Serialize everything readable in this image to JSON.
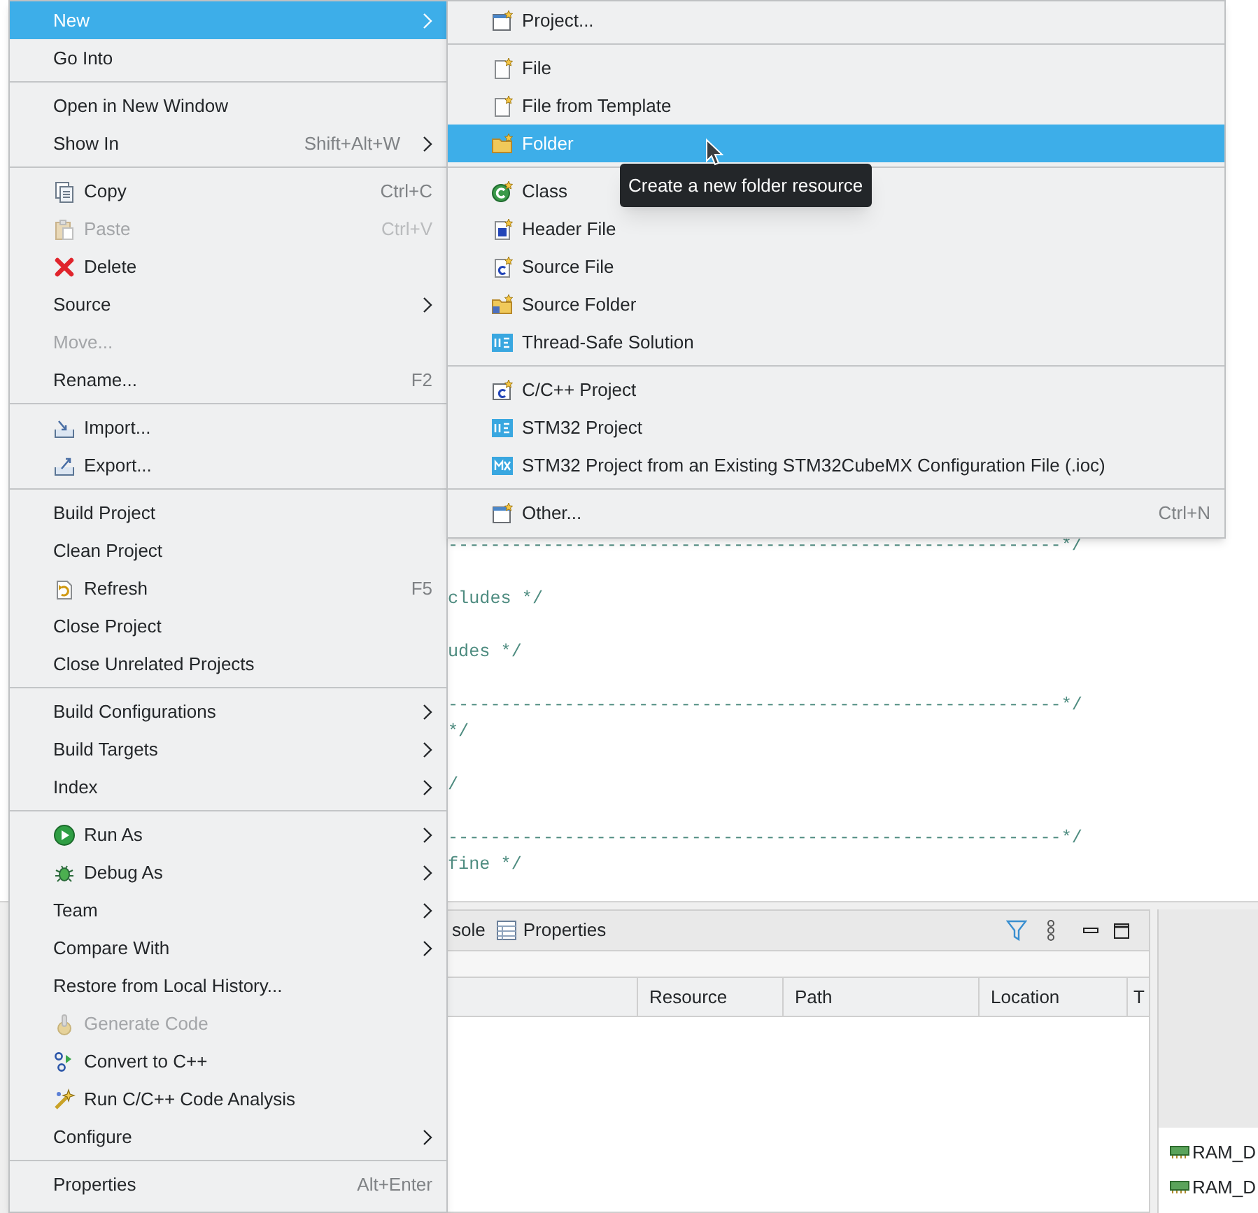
{
  "editor": {
    "lines": [
      "----------------------------------------------------------*/",
      "cludes */",
      "udes */",
      "----------------------------------------------------------*/",
      "*/",
      "/",
      "----------------------------------------------------------*/",
      "fine */"
    ]
  },
  "bottom_panel": {
    "tabs": [
      {
        "label": "sole",
        "selected": false
      },
      {
        "label": "Properties",
        "selected": false
      }
    ],
    "table": {
      "columns": [
        "Resource",
        "Path",
        "Location",
        "T"
      ]
    }
  },
  "outline_panel": {
    "items": [
      {
        "label": "RAM_D"
      },
      {
        "label": "RAM_D"
      }
    ]
  },
  "context_menu": {
    "items": [
      {
        "kind": "item",
        "label": "New",
        "submenu": true,
        "selected": true,
        "disabled": false
      },
      {
        "kind": "item",
        "label": "Go Into",
        "submenu": false,
        "selected": false,
        "disabled": false
      },
      {
        "kind": "separator"
      },
      {
        "kind": "item",
        "label": "Open in New Window",
        "submenu": false,
        "selected": false,
        "disabled": false
      },
      {
        "kind": "item",
        "label": "Show In",
        "shortcut": "Shift+Alt+W",
        "submenu": true,
        "selected": false,
        "disabled": false
      },
      {
        "kind": "separator"
      },
      {
        "kind": "item",
        "label": "Copy",
        "shortcut": "Ctrl+C",
        "submenu": false,
        "selected": false,
        "disabled": false
      },
      {
        "kind": "item",
        "label": "Paste",
        "shortcut": "Ctrl+V",
        "submenu": false,
        "selected": false,
        "disabled": true
      },
      {
        "kind": "item",
        "label": "Delete",
        "submenu": false,
        "selected": false,
        "disabled": false
      },
      {
        "kind": "item",
        "label": "Source",
        "submenu": true,
        "selected": false,
        "disabled": false
      },
      {
        "kind": "item",
        "label": "Move...",
        "submenu": false,
        "selected": false,
        "disabled": true
      },
      {
        "kind": "item",
        "label": "Rename...",
        "shortcut": "F2",
        "submenu": false,
        "selected": false,
        "disabled": false
      },
      {
        "kind": "separator"
      },
      {
        "kind": "item",
        "label": "Import...",
        "submenu": false,
        "selected": false,
        "disabled": false
      },
      {
        "kind": "item",
        "label": "Export...",
        "submenu": false,
        "selected": false,
        "disabled": false
      },
      {
        "kind": "separator"
      },
      {
        "kind": "item",
        "label": "Build Project",
        "submenu": false,
        "selected": false,
        "disabled": false
      },
      {
        "kind": "item",
        "label": "Clean Project",
        "submenu": false,
        "selected": false,
        "disabled": false
      },
      {
        "kind": "item",
        "label": "Refresh",
        "shortcut": "F5",
        "submenu": false,
        "selected": false,
        "disabled": false
      },
      {
        "kind": "item",
        "label": "Close Project",
        "submenu": false,
        "selected": false,
        "disabled": false
      },
      {
        "kind": "item",
        "label": "Close Unrelated Projects",
        "submenu": false,
        "selected": false,
        "disabled": false
      },
      {
        "kind": "separator"
      },
      {
        "kind": "item",
        "label": "Build Configurations",
        "submenu": true,
        "selected": false,
        "disabled": false
      },
      {
        "kind": "item",
        "label": "Build Targets",
        "submenu": true,
        "selected": false,
        "disabled": false
      },
      {
        "kind": "item",
        "label": "Index",
        "submenu": true,
        "selected": false,
        "disabled": false
      },
      {
        "kind": "separator"
      },
      {
        "kind": "item",
        "label": "Run As",
        "submenu": true,
        "selected": false,
        "disabled": false
      },
      {
        "kind": "item",
        "label": "Debug As",
        "submenu": true,
        "selected": false,
        "disabled": false
      },
      {
        "kind": "item",
        "label": "Team",
        "submenu": true,
        "selected": false,
        "disabled": false
      },
      {
        "kind": "item",
        "label": "Compare With",
        "submenu": true,
        "selected": false,
        "disabled": false
      },
      {
        "kind": "item",
        "label": "Restore from Local History...",
        "submenu": false,
        "selected": false,
        "disabled": false
      },
      {
        "kind": "item",
        "label": "Generate Code",
        "submenu": false,
        "selected": false,
        "disabled": true
      },
      {
        "kind": "item",
        "label": "Convert to C++",
        "submenu": false,
        "selected": false,
        "disabled": false
      },
      {
        "kind": "item",
        "label": "Run C/C++ Code Analysis",
        "submenu": false,
        "selected": false,
        "disabled": false
      },
      {
        "kind": "item",
        "label": "Configure",
        "submenu": true,
        "selected": false,
        "disabled": false
      },
      {
        "kind": "separator"
      },
      {
        "kind": "item",
        "label": "Properties",
        "shortcut": "Alt+Enter",
        "submenu": false,
        "selected": false,
        "disabled": false
      }
    ]
  },
  "new_submenu": {
    "items": [
      {
        "kind": "item",
        "label": "Project...",
        "selected": false
      },
      {
        "kind": "separator"
      },
      {
        "kind": "item",
        "label": "File",
        "selected": false
      },
      {
        "kind": "item",
        "label": "File from Template",
        "selected": false
      },
      {
        "kind": "item",
        "label": "Folder",
        "selected": true
      },
      {
        "kind": "separator"
      },
      {
        "kind": "item",
        "label": "Class",
        "selected": false
      },
      {
        "kind": "item",
        "label": "Header File",
        "selected": false
      },
      {
        "kind": "item",
        "label": "Source File",
        "selected": false
      },
      {
        "kind": "item",
        "label": "Source Folder",
        "selected": false
      },
      {
        "kind": "item",
        "label": "Thread-Safe Solution",
        "selected": false
      },
      {
        "kind": "separator"
      },
      {
        "kind": "item",
        "label": "C/C++ Project",
        "selected": false
      },
      {
        "kind": "item",
        "label": "STM32 Project",
        "selected": false
      },
      {
        "kind": "item",
        "label": "STM32 Project from an Existing STM32CubeMX Configuration File (.ioc)",
        "selected": false
      },
      {
        "kind": "separator"
      },
      {
        "kind": "item",
        "label": "Other...",
        "shortcut": "Ctrl+N",
        "selected": false
      }
    ]
  },
  "tooltip": {
    "text": "Create a new folder resource"
  }
}
